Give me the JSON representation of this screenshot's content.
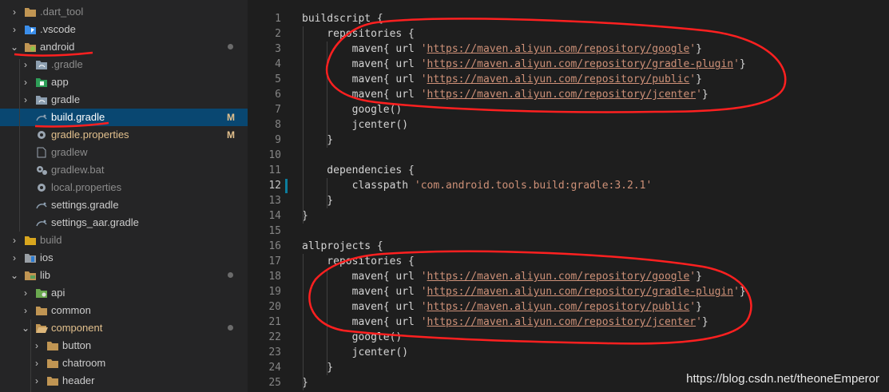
{
  "explorer": {
    "items": [
      {
        "label": ".dart_tool",
        "icon": "folder-icon",
        "chevron": "›",
        "badge": "",
        "state": "dim"
      },
      {
        "label": ".vscode",
        "icon": "vscode-folder-icon",
        "chevron": "›",
        "badge": "",
        "state": ""
      },
      {
        "label": "android",
        "icon": "android-folder-icon",
        "chevron": "⌄",
        "badge": "",
        "dot": true,
        "state": ""
      },
      {
        "label": ".gradle",
        "icon": "gradle-folder-icon",
        "chevron": "›",
        "badge": "",
        "state": "dim"
      },
      {
        "label": "app",
        "icon": "app-folder-icon",
        "chevron": "›",
        "badge": "",
        "state": ""
      },
      {
        "label": "gradle",
        "icon": "gradle-folder-icon",
        "chevron": "›",
        "badge": "",
        "state": ""
      },
      {
        "label": "build.gradle",
        "icon": "gradle-file-icon",
        "chevron": "",
        "badge": "M",
        "state": "selected"
      },
      {
        "label": "gradle.properties",
        "icon": "gear-icon",
        "chevron": "",
        "badge": "M",
        "state": "modified"
      },
      {
        "label": "gradlew",
        "icon": "file-icon",
        "chevron": "",
        "badge": "",
        "state": "dim"
      },
      {
        "label": "gradlew.bat",
        "icon": "gears-icon",
        "chevron": "",
        "badge": "",
        "state": "dim"
      },
      {
        "label": "local.properties",
        "icon": "gear-icon",
        "chevron": "",
        "badge": "",
        "state": "dim"
      },
      {
        "label": "settings.gradle",
        "icon": "gradle-file-icon",
        "chevron": "",
        "badge": "",
        "state": ""
      },
      {
        "label": "settings_aar.gradle",
        "icon": "gradle-file-icon",
        "chevron": "",
        "badge": "",
        "state": ""
      },
      {
        "label": "build",
        "icon": "build-folder-icon",
        "chevron": "›",
        "badge": "",
        "state": "dim"
      },
      {
        "label": "ios",
        "icon": "ios-folder-icon",
        "chevron": "›",
        "badge": "",
        "state": ""
      },
      {
        "label": "lib",
        "icon": "lib-folder-icon",
        "chevron": "⌄",
        "badge": "",
        "dot": true,
        "state": ""
      },
      {
        "label": "api",
        "icon": "api-folder-icon",
        "chevron": "›",
        "badge": "",
        "state": ""
      },
      {
        "label": "common",
        "icon": "folder-icon",
        "chevron": "›",
        "badge": "",
        "state": ""
      },
      {
        "label": "component",
        "icon": "open-folder-icon",
        "chevron": "⌄",
        "badge": "",
        "dot": true,
        "state": "modified"
      },
      {
        "label": "button",
        "icon": "folder-icon",
        "chevron": "›",
        "badge": "",
        "state": ""
      },
      {
        "label": "chatroom",
        "icon": "folder-icon",
        "chevron": "›",
        "badge": "",
        "state": ""
      },
      {
        "label": "header",
        "icon": "folder-icon",
        "chevron": "›",
        "badge": "",
        "state": ""
      }
    ]
  },
  "editor": {
    "current_line": 12,
    "lines": [
      {
        "n": "1",
        "t": "buildscript {"
      },
      {
        "n": "2",
        "t": "    repositories {"
      },
      {
        "n": "3",
        "t": "        maven{ url 'https://maven.aliyun.com/repository/google'}"
      },
      {
        "n": "4",
        "t": "        maven{ url 'https://maven.aliyun.com/repository/gradle-plugin'}"
      },
      {
        "n": "5",
        "t": "        maven{ url 'https://maven.aliyun.com/repository/public'}"
      },
      {
        "n": "6",
        "t": "        maven{ url 'https://maven.aliyun.com/repository/jcenter'}"
      },
      {
        "n": "7",
        "t": "        google()"
      },
      {
        "n": "8",
        "t": "        jcenter()"
      },
      {
        "n": "9",
        "t": "    }"
      },
      {
        "n": "10",
        "t": ""
      },
      {
        "n": "11",
        "t": "    dependencies {"
      },
      {
        "n": "12",
        "t": "        classpath 'com.android.tools.build:gradle:3.2.1'"
      },
      {
        "n": "13",
        "t": "    }"
      },
      {
        "n": "14",
        "t": "}"
      },
      {
        "n": "15",
        "t": ""
      },
      {
        "n": "16",
        "t": "allprojects {"
      },
      {
        "n": "17",
        "t": "    repositories {"
      },
      {
        "n": "18",
        "t": "        maven{ url 'https://maven.aliyun.com/repository/google'}"
      },
      {
        "n": "19",
        "t": "        maven{ url 'https://maven.aliyun.com/repository/gradle-plugin'}"
      },
      {
        "n": "20",
        "t": "        maven{ url 'https://maven.aliyun.com/repository/public'}"
      },
      {
        "n": "21",
        "t": "        maven{ url 'https://maven.aliyun.com/repository/jcenter'}"
      },
      {
        "n": "22",
        "t": "        google()"
      },
      {
        "n": "23",
        "t": "        jcenter()"
      },
      {
        "n": "24",
        "t": "    }"
      },
      {
        "n": "25",
        "t": "}"
      }
    ]
  },
  "watermark": "https://blog.csdn.net/theoneEmperor",
  "colors": {
    "sidebar_bg": "#252526",
    "editor_bg": "#1e1e1e",
    "selection": "#094771",
    "modified": "#e2c08d",
    "string": "#ce9178",
    "annotation": "#ff2020"
  }
}
